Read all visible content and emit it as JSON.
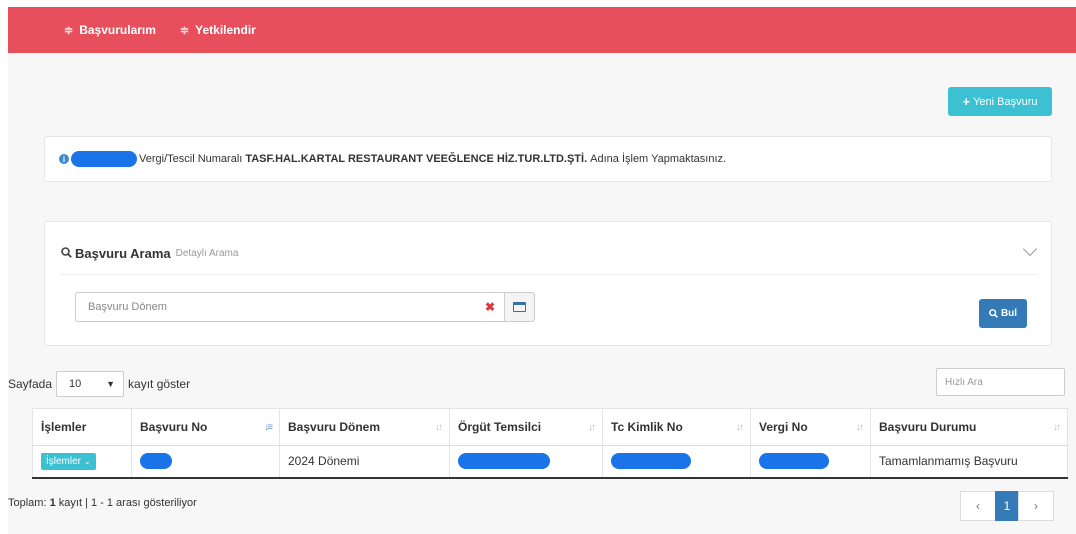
{
  "nav": {
    "items": [
      {
        "label": "Başvurularım",
        "icon": "list-icon"
      },
      {
        "label": "Yetkilendir",
        "icon": "list-icon"
      }
    ]
  },
  "toolbar": {
    "new_application_label": "Yeni Başvuru"
  },
  "info": {
    "pre_text": "Vergi/Tescil Numaralı",
    "company_name": "TASF.HAL.KARTAL RESTAURANT VEEĞLENCE HİZ.TUR.LTD.ŞTİ.",
    "post_text": "Adına İşlem Yapmaktasınız."
  },
  "search": {
    "title": "Başvuru Arama",
    "subtitle": "Detaylı Arama",
    "period_placeholder": "Başvuru Dönem",
    "find_label": "Bul"
  },
  "list_controls": {
    "length_prefix": "Sayfada",
    "length_value": "10",
    "length_suffix": "kayıt göster",
    "quick_search_placeholder": "Hızlı Ara"
  },
  "table": {
    "columns": [
      "İşlemler",
      "Başvuru No",
      "Başvuru Dönem",
      "Örgüt Temsilci",
      "Tc Kimlik No",
      "Vergi No",
      "Başvuru Durumu"
    ],
    "rows": [
      {
        "actions_label": "İşlemler",
        "period": "2024 Dönemi",
        "status": "Tamamlanmamış Başvuru"
      }
    ]
  },
  "summary": {
    "prefix": "Toplam:",
    "count": "1",
    "rest": "kayıt | 1 - 1 arası gösteriliyor"
  },
  "pagination": {
    "prev": "‹",
    "current": "1",
    "next": "›"
  },
  "colors": {
    "topbar": "#e84f5c",
    "accent_cyan": "#3bc1d2",
    "primary_blue": "#337ab7",
    "redaction": "#1a73e8"
  }
}
